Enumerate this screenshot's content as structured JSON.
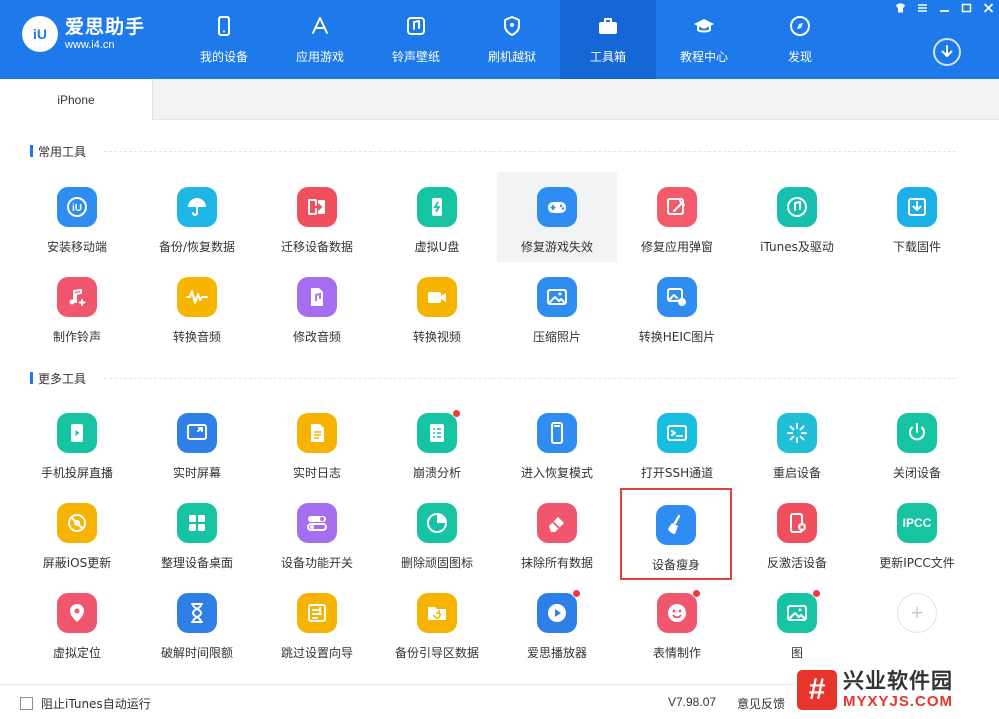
{
  "app": {
    "title": "爱思助手",
    "url": "www.i4.cn",
    "logo_mark": "iU"
  },
  "nav": [
    {
      "label": "我的设备",
      "icon": "phone-icon"
    },
    {
      "label": "应用游戏",
      "icon": "app-store-icon"
    },
    {
      "label": "铃声壁纸",
      "icon": "music-note-icon"
    },
    {
      "label": "刷机越狱",
      "icon": "shield-key-icon"
    },
    {
      "label": "工具箱",
      "icon": "toolbox-icon",
      "active": true
    },
    {
      "label": "教程中心",
      "icon": "graduation-cap-icon"
    },
    {
      "label": "发现",
      "icon": "compass-icon"
    }
  ],
  "tabs": [
    {
      "label": "iPhone"
    }
  ],
  "sections": {
    "common": {
      "title": "常用工具",
      "items": [
        {
          "label": "安装移动端",
          "icon": "i4-logo-icon",
          "color": "#2f8cf0"
        },
        {
          "label": "备份/恢复数据",
          "icon": "umbrella-icon",
          "color": "#1fb6e6"
        },
        {
          "label": "迁移设备数据",
          "icon": "transfer-icon",
          "color": "#f0505e"
        },
        {
          "label": "虚拟U盘",
          "icon": "usb-drive-icon",
          "color": "#16c3a3"
        },
        {
          "label": "修复游戏失效",
          "icon": "gamepad-icon",
          "color": "#2f8cf0"
        },
        {
          "label": "修复应用弹窗",
          "icon": "wrench-window-icon",
          "color": "#f45b6a"
        },
        {
          "label": "iTunes及驱动",
          "icon": "itunes-icon",
          "color": "#16bfae"
        },
        {
          "label": "下载固件",
          "icon": "download-box-icon",
          "color": "#1bb0e8"
        },
        {
          "label": "制作铃声",
          "icon": "ringtone-icon",
          "color": "#f0566e"
        },
        {
          "label": "转换音频",
          "icon": "waveform-icon",
          "color": "#f7b500"
        },
        {
          "label": "修改音频",
          "icon": "audio-file-icon",
          "color": "#a56ef0"
        },
        {
          "label": "转换视频",
          "icon": "video-camera-icon",
          "color": "#f6b400"
        },
        {
          "label": "压缩照片",
          "icon": "photo-icon",
          "color": "#2f8cf0"
        },
        {
          "label": "转换HEIC图片",
          "icon": "heic-photo-icon",
          "color": "#2f8cf0"
        }
      ]
    },
    "more": {
      "title": "更多工具",
      "items": [
        {
          "label": "手机投屏直播",
          "icon": "screen-mirror-icon",
          "color": "#16c3a3"
        },
        {
          "label": "实时屏幕",
          "icon": "cast-screen-icon",
          "color": "#2f7fe8"
        },
        {
          "label": "实时日志",
          "icon": "log-document-icon",
          "color": "#f6b400"
        },
        {
          "label": "崩溃分析",
          "icon": "crash-report-icon",
          "color": "#16c3a3",
          "dot": true
        },
        {
          "label": "进入恢复模式",
          "icon": "recovery-phone-icon",
          "color": "#2f8cf0"
        },
        {
          "label": "打开SSH通道",
          "icon": "terminal-icon",
          "color": "#16bfe0"
        },
        {
          "label": "重启设备",
          "icon": "restart-spinner-icon",
          "color": "#1fbfd8"
        },
        {
          "label": "关闭设备",
          "icon": "power-icon",
          "color": "#16c3a3"
        },
        {
          "label": "屏蔽iOS更新",
          "icon": "block-update-icon",
          "color": "#f6b400"
        },
        {
          "label": "整理设备桌面",
          "icon": "grid-apps-icon",
          "color": "#16c3a3"
        },
        {
          "label": "设备功能开关",
          "icon": "toggle-switch-icon",
          "color": "#a56ef0"
        },
        {
          "label": "删除顽固图标",
          "icon": "pie-delete-icon",
          "color": "#16c3a3"
        },
        {
          "label": "抹除所有数据",
          "icon": "eraser-icon",
          "color": "#f0566e"
        },
        {
          "label": "设备瘦身",
          "icon": "broom-icon",
          "color": "#2f8cf0",
          "selected": true
        },
        {
          "label": "反激活设备",
          "icon": "deactivate-phone-icon",
          "color": "#f0505e"
        },
        {
          "label": "更新IPCC文件",
          "icon": "ipcc-icon",
          "color": "#16c3a3",
          "text": "IPCC"
        },
        {
          "label": "虚拟定位",
          "icon": "location-pin-icon",
          "color": "#f0566e"
        },
        {
          "label": "破解时间限额",
          "icon": "hourglass-icon",
          "color": "#2f7fe8"
        },
        {
          "label": "跳过设置向导",
          "icon": "skip-wizard-icon",
          "color": "#f6b400"
        },
        {
          "label": "备份引导区数据",
          "icon": "backup-folder-icon",
          "color": "#f6b400"
        },
        {
          "label": "爱思播放器",
          "icon": "play-button-icon",
          "color": "#2f7fe8",
          "dot": true
        },
        {
          "label": "表情制作",
          "icon": "emoji-face-icon",
          "color": "#f0566e",
          "dot": true
        },
        {
          "label": "图",
          "icon": "image-icon",
          "color": "#16c3a3",
          "dot": true
        },
        {
          "label": "",
          "icon": "add-icon",
          "add": true
        }
      ]
    }
  },
  "footer": {
    "checkbox_label": "阻止iTunes自动运行",
    "version": "V7.98.07",
    "feedback": "意见反馈"
  },
  "watermark": {
    "title": "兴业软件园",
    "url": "MYXYJS.COM",
    "logo_glyph": "#"
  }
}
